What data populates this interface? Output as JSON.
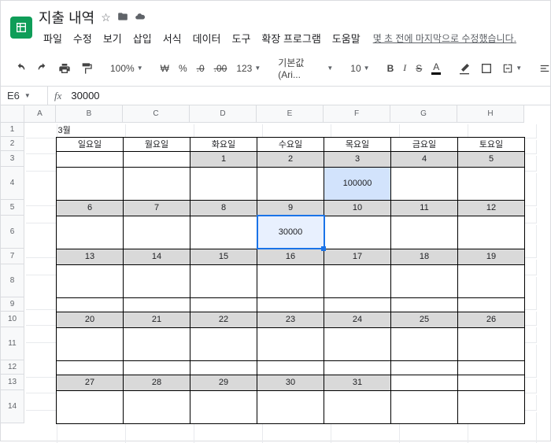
{
  "doc_title": "지출 내역",
  "menubar": {
    "file": "파일",
    "edit": "수정",
    "view": "보기",
    "insert": "삽입",
    "format": "서식",
    "data": "데이터",
    "tools": "도구",
    "extensions": "확장 프로그램",
    "help": "도움말",
    "last_edit": "몇 초 전에 마지막으로 수정했습니다."
  },
  "toolbar": {
    "zoom": "100%",
    "currency": "₩",
    "percent": "%",
    "dec_dec": ".0",
    "dec_inc": ".00",
    "more_fmt": "123",
    "font": "기본값 (Ari...",
    "font_size": "10"
  },
  "fx": {
    "cell_ref": "E6",
    "value": "30000"
  },
  "col_labels": [
    "A",
    "B",
    "C",
    "D",
    "E",
    "F",
    "G",
    "H"
  ],
  "row_labels": [
    "1",
    "2",
    "3",
    "4",
    "5",
    "6",
    "7",
    "8",
    "9",
    "10",
    "11",
    "12",
    "13",
    "14"
  ],
  "cal": {
    "month": "3월",
    "days": [
      "일요일",
      "월요일",
      "화요일",
      "수요일",
      "목요일",
      "금요일",
      "토요일"
    ],
    "weeks": [
      {
        "dates": [
          "",
          "",
          "1",
          "2",
          "3",
          "4",
          "5"
        ],
        "values": [
          "",
          "",
          "",
          "",
          "100000",
          "",
          ""
        ]
      },
      {
        "dates": [
          "6",
          "7",
          "8",
          "9",
          "10",
          "11",
          "12"
        ],
        "values": [
          "",
          "",
          "",
          "30000",
          "",
          "",
          ""
        ]
      },
      {
        "dates": [
          "13",
          "14",
          "15",
          "16",
          "17",
          "18",
          "19"
        ],
        "values": [
          "",
          "",
          "",
          "",
          "",
          "",
          ""
        ]
      },
      {
        "dates": [
          "20",
          "21",
          "22",
          "23",
          "24",
          "25",
          "26"
        ],
        "values": [
          "",
          "",
          "",
          "",
          "",
          "",
          ""
        ]
      },
      {
        "dates": [
          "27",
          "28",
          "29",
          "30",
          "31",
          "",
          ""
        ],
        "values": [
          "",
          "",
          "",
          "",
          "",
          "",
          ""
        ]
      }
    ]
  },
  "chart_data": {
    "type": "table",
    "title": "지출 내역 — 3월",
    "columns": [
      "일요일",
      "월요일",
      "화요일",
      "수요일",
      "목요일",
      "금요일",
      "토요일"
    ],
    "rows": [
      {
        "dates": [
          "",
          "",
          "1",
          "2",
          "3",
          "4",
          "5"
        ],
        "values": [
          null,
          null,
          null,
          null,
          100000,
          null,
          null
        ]
      },
      {
        "dates": [
          "6",
          "7",
          "8",
          "9",
          "10",
          "11",
          "12"
        ],
        "values": [
          null,
          null,
          null,
          30000,
          null,
          null,
          null
        ]
      },
      {
        "dates": [
          "13",
          "14",
          "15",
          "16",
          "17",
          "18",
          "19"
        ],
        "values": [
          null,
          null,
          null,
          null,
          null,
          null,
          null
        ]
      },
      {
        "dates": [
          "20",
          "21",
          "22",
          "23",
          "24",
          "25",
          "26"
        ],
        "values": [
          null,
          null,
          null,
          null,
          null,
          null,
          null
        ]
      },
      {
        "dates": [
          "27",
          "28",
          "29",
          "30",
          "31",
          "",
          ""
        ],
        "values": [
          null,
          null,
          null,
          null,
          null,
          null,
          null
        ]
      }
    ]
  }
}
